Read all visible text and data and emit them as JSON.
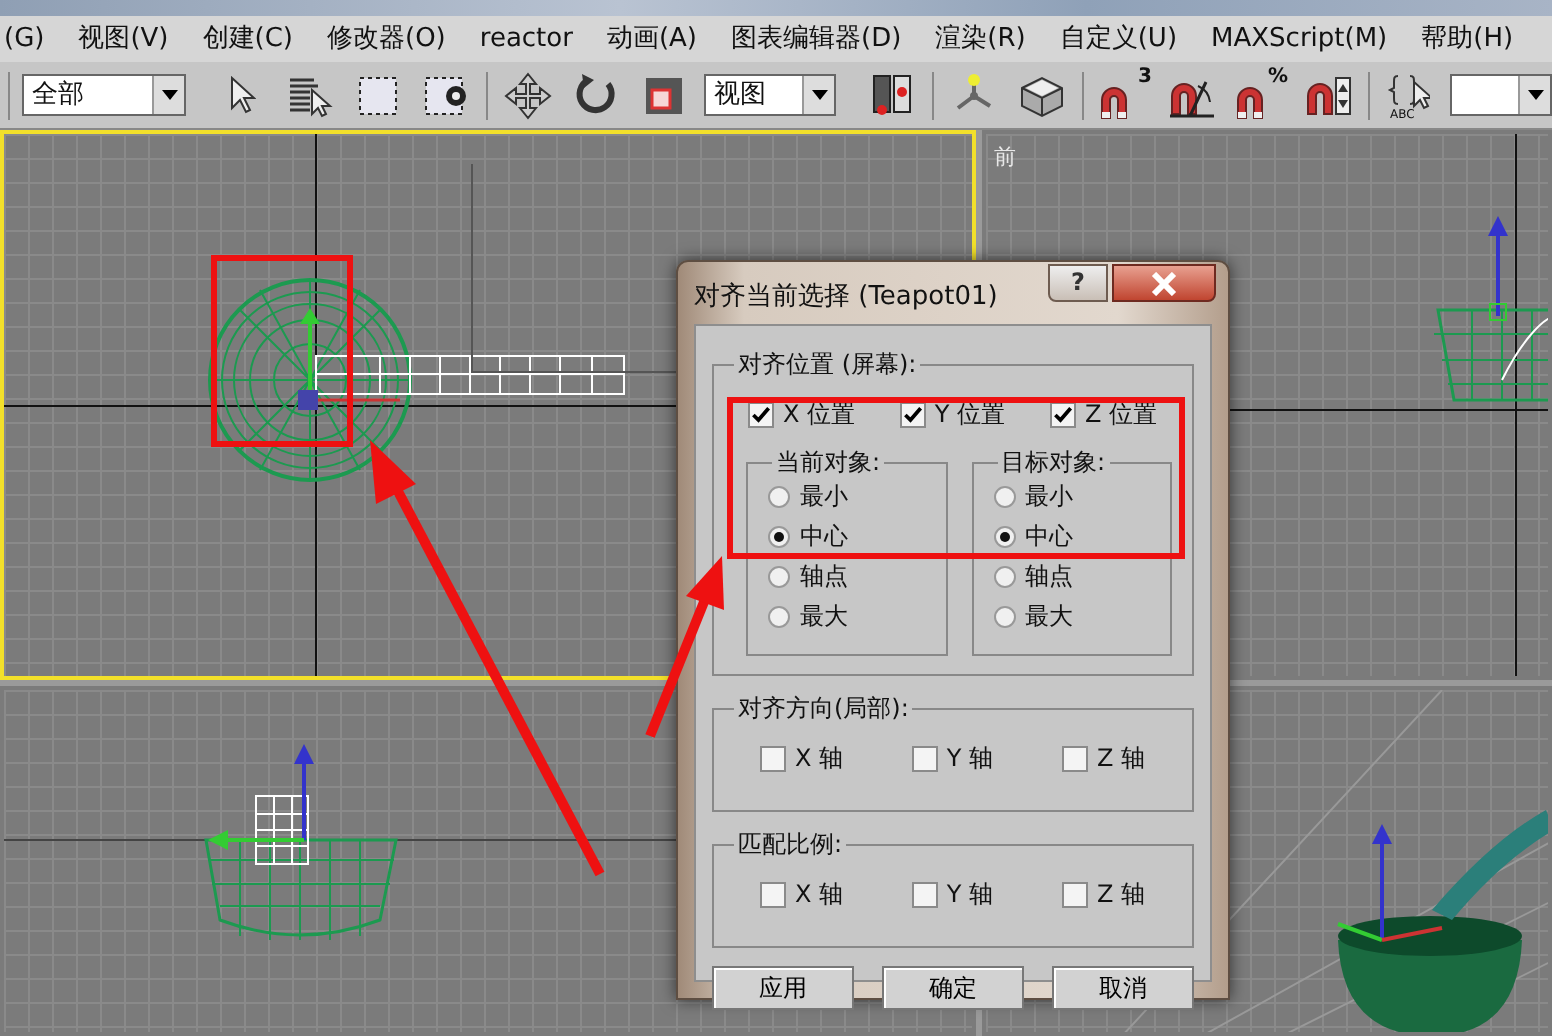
{
  "menu_bar": [
    "(G)",
    "视图(V)",
    "创建(C)",
    "修改器(O)",
    "reactor",
    "动画(A)",
    "图表编辑器(D)",
    "渲染(R)",
    "自定义(U)",
    "MAXScript(M)",
    "帮助(H)"
  ],
  "toolbar": {
    "selection_filter": "全部",
    "reference_coordinate": "视图",
    "snap_label": "3",
    "percent_snap_label": "%",
    "named_selection_label": "ABC"
  },
  "viewports": [
    {
      "active": true
    },
    {
      "label": "前",
      "active": false
    },
    {
      "active": false
    },
    {
      "active": false
    }
  ],
  "dialog": {
    "title": "对齐当前选择 (Teapot01)",
    "help_button": "?",
    "align_position": {
      "title": "对齐位置 (屏幕):",
      "axes": [
        {
          "label": "X 位置",
          "checked": true
        },
        {
          "label": "Y 位置",
          "checked": true
        },
        {
          "label": "Z 位置",
          "checked": true
        }
      ],
      "current_object": {
        "title": "当前对象:",
        "options": [
          {
            "label": "最小",
            "selected": false
          },
          {
            "label": "中心",
            "selected": true
          },
          {
            "label": "轴点",
            "selected": false
          },
          {
            "label": "最大",
            "selected": false
          }
        ]
      },
      "target_object": {
        "title": "目标对象:",
        "options": [
          {
            "label": "最小",
            "selected": false
          },
          {
            "label": "中心",
            "selected": true
          },
          {
            "label": "轴点",
            "selected": false
          },
          {
            "label": "最大",
            "selected": false
          }
        ]
      }
    },
    "align_orientation": {
      "title": "对齐方向(局部):",
      "axes": [
        {
          "label": "X 轴",
          "checked": false
        },
        {
          "label": "Y 轴",
          "checked": false
        },
        {
          "label": "Z 轴",
          "checked": false
        }
      ]
    },
    "match_scale": {
      "title": "匹配比例:",
      "axes": [
        {
          "label": "X 轴",
          "checked": false
        },
        {
          "label": "Y 轴",
          "checked": false
        },
        {
          "label": "Z 轴",
          "checked": false
        }
      ]
    },
    "buttons": [
      "应用",
      "确定",
      "取消"
    ]
  }
}
